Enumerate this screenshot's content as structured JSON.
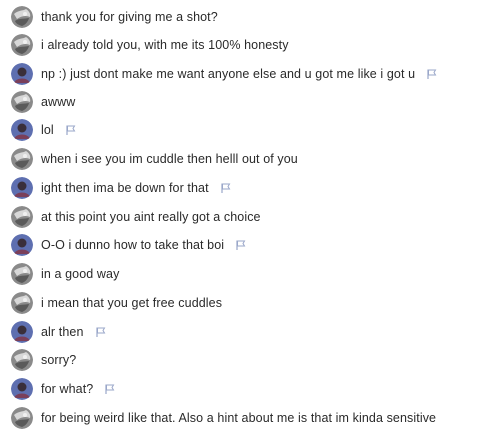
{
  "colors": {
    "text": "#2a2a2a",
    "stranger_avatar": "#8a8a8a",
    "self_avatar": "#5e6fb0",
    "flag_icon": "#9aa7c9"
  },
  "messages": [
    {
      "sender": "stranger",
      "avatar_icon": "grey-avatar-icon",
      "text": "thank you for giving me a shot?",
      "flag": false
    },
    {
      "sender": "stranger",
      "avatar_icon": "grey-avatar-icon",
      "text": "i already told you, with me its 100% honesty",
      "flag": false
    },
    {
      "sender": "self",
      "avatar_icon": "blue-avatar-icon",
      "text": "np :) just dont make me want anyone else and u got me like i got u",
      "flag": true
    },
    {
      "sender": "stranger",
      "avatar_icon": "grey-avatar-icon",
      "text": "awww",
      "flag": false
    },
    {
      "sender": "self",
      "avatar_icon": "blue-avatar-icon",
      "text": "lol",
      "flag": true
    },
    {
      "sender": "stranger",
      "avatar_icon": "grey-avatar-icon",
      "text": "when i see you im cuddle then helll out of you",
      "flag": false
    },
    {
      "sender": "self",
      "avatar_icon": "blue-avatar-icon",
      "text": "ight then ima be down for that",
      "flag": true
    },
    {
      "sender": "stranger",
      "avatar_icon": "grey-avatar-icon",
      "text": "at this point you aint really got a choice",
      "flag": false
    },
    {
      "sender": "self",
      "avatar_icon": "blue-avatar-icon",
      "text": "O-O i dunno how to take that boi",
      "flag": true
    },
    {
      "sender": "stranger",
      "avatar_icon": "grey-avatar-icon",
      "text": "in a good way",
      "flag": false
    },
    {
      "sender": "stranger",
      "avatar_icon": "grey-avatar-icon",
      "text": "i mean that you get free cuddles",
      "flag": false
    },
    {
      "sender": "self",
      "avatar_icon": "blue-avatar-icon",
      "text": "alr then",
      "flag": true
    },
    {
      "sender": "stranger",
      "avatar_icon": "grey-avatar-icon",
      "text": "sorry?",
      "flag": false
    },
    {
      "sender": "self",
      "avatar_icon": "blue-avatar-icon",
      "text": "for what?",
      "flag": true
    },
    {
      "sender": "stranger",
      "avatar_icon": "grey-avatar-icon",
      "text": "for being weird like that. Also a hint about me is that im kinda sensitive",
      "flag": false
    }
  ]
}
